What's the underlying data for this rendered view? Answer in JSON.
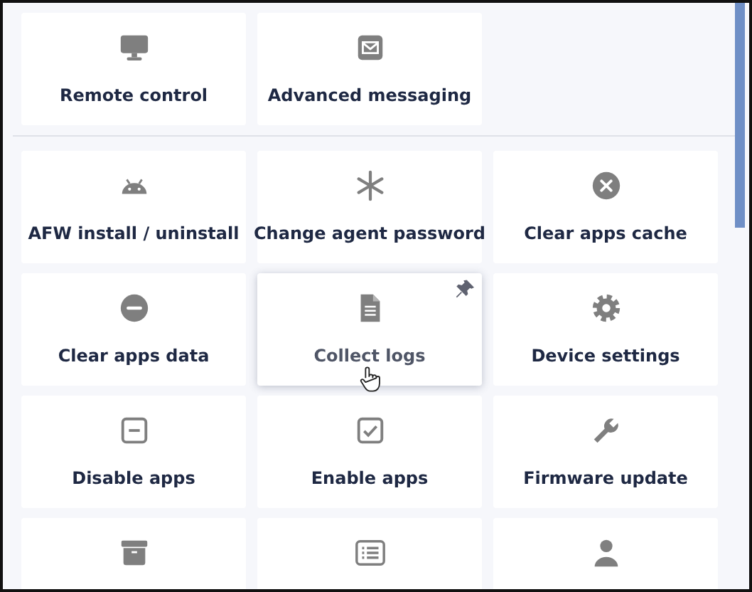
{
  "sections": [
    {
      "items": [
        {
          "label": "Remote control",
          "hovered": false
        },
        {
          "label": "Advanced messaging",
          "hovered": false
        }
      ]
    },
    {
      "items": [
        {
          "label": "AFW install / uninstall",
          "hovered": false
        },
        {
          "label": "Change agent password",
          "hovered": false
        },
        {
          "label": "Clear apps cache",
          "hovered": false
        },
        {
          "label": "Clear apps data",
          "hovered": false
        },
        {
          "label": "Collect logs",
          "hovered": true
        },
        {
          "label": "Device settings",
          "hovered": false
        },
        {
          "label": "Disable apps",
          "hovered": false
        },
        {
          "label": "Enable apps",
          "hovered": false
        },
        {
          "label": "Firmware update",
          "hovered": false
        },
        {
          "hovered": false
        },
        {
          "hovered": false
        },
        {
          "hovered": false
        }
      ]
    }
  ]
}
